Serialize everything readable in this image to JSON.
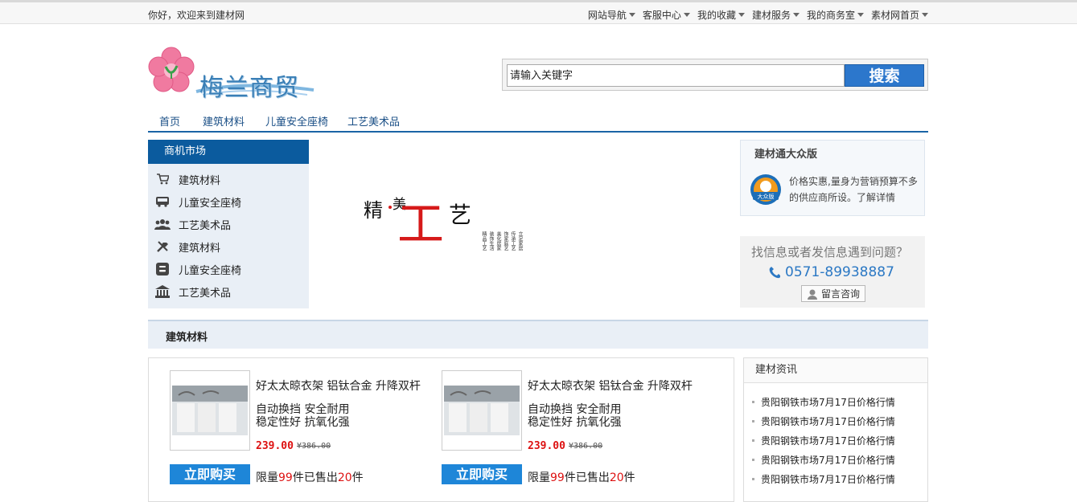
{
  "topbar": {
    "welcome": "你好，欢迎来到建材网",
    "nav": [
      "网站导航",
      "客服中心",
      "我的收藏",
      "建材服务",
      "我的商务室",
      "素材网首页"
    ]
  },
  "logo": {
    "name": "梅兰商贸"
  },
  "search": {
    "placeholder": "请输入关键字",
    "button": "搜索"
  },
  "mainnav": [
    "首页",
    "建筑材料",
    "儿童安全座椅",
    "工艺美术品"
  ],
  "sidebar": {
    "title": "商机市场",
    "items": [
      {
        "label": "建筑材料",
        "icon": "cart-icon"
      },
      {
        "label": "儿童安全座椅",
        "icon": "bus-icon"
      },
      {
        "label": "工艺美术品",
        "icon": "users-icon"
      },
      {
        "label": "建筑材料",
        "icon": "tools-icon"
      },
      {
        "label": "儿童安全座椅",
        "icon": "blogger-icon"
      },
      {
        "label": "工艺美术品",
        "icon": "bank-icon"
      }
    ]
  },
  "banner": {
    "jing": "精",
    "mei": "美",
    "gong": "工",
    "yi": "艺",
    "vertical": [
      "立足家居",
      "传承工艺",
      "饰家庭艺",
      "美化居家",
      "装饰生活",
      "精品工艺"
    ]
  },
  "promo": {
    "title": "建材通大众版",
    "badge_text": "大众版",
    "text": "价格实惠,量身为营销预算不多的供应商所设。了解详情"
  },
  "contact": {
    "question": "找信息或者发信息遇到问题？",
    "phone": "0571-89938887",
    "button": "留言咨询"
  },
  "section": {
    "title": "建筑材料"
  },
  "products": [
    {
      "title": "好太太晾衣架 铝钛合金 升降双杆",
      "desc1": "自动换挡 安全耐用",
      "desc2": "稳定性好 抗氧化强",
      "price": "239.00",
      "old_price": "¥386.00",
      "buy": "立即购买",
      "limit_prefix": "限量",
      "limit_num": "99",
      "sold_text": "件已售出",
      "sold_num": "20",
      "unit": "件"
    },
    {
      "title": "好太太晾衣架 铝钛合金 升降双杆",
      "desc1": "自动换挡 安全耐用",
      "desc2": "稳定性好 抗氧化强",
      "price": "239.00",
      "old_price": "¥386.00",
      "buy": "立即购买",
      "limit_prefix": "限量",
      "limit_num": "99",
      "sold_text": "件已售出",
      "sold_num": "20",
      "unit": "件"
    }
  ],
  "news": {
    "title": "建材资讯",
    "items": [
      "贵阳钢铁市场7月17日价格行情",
      "贵阳钢铁市场7月17日价格行情",
      "贵阳钢铁市场7月17日价格行情",
      "贵阳钢铁市场7月17日价格行情",
      "贵阳钢铁市场7月17日价格行情"
    ]
  },
  "colors": {
    "brand_blue": "#0b5b9e",
    "accent_red": "#d61a1a",
    "button_blue": "#1e86d8"
  }
}
